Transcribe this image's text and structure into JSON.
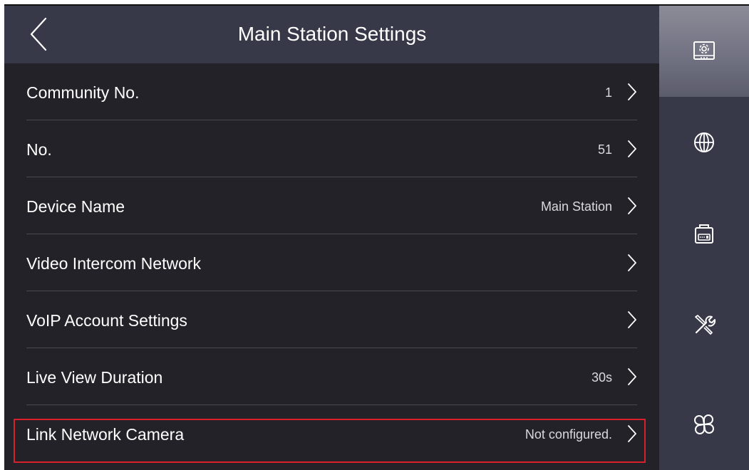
{
  "header": {
    "title": "Main Station Settings",
    "back_icon": "chevron-left-icon"
  },
  "settings": [
    {
      "label": "Community No.",
      "value": "1"
    },
    {
      "label": "No.",
      "value": "51"
    },
    {
      "label": "Device Name",
      "value": "Main Station"
    },
    {
      "label": "Video Intercom Network",
      "value": ""
    },
    {
      "label": "VoIP Account Settings",
      "value": ""
    },
    {
      "label": "Live View Duration",
      "value": "30s"
    },
    {
      "label": "Link Network Camera",
      "value": "Not configured.",
      "highlighted": true
    }
  ],
  "sidebar": {
    "items": [
      {
        "icon": "device-settings-icon",
        "active": true
      },
      {
        "icon": "globe-icon",
        "active": false
      },
      {
        "icon": "intercom-device-icon",
        "active": false
      },
      {
        "icon": "tools-icon",
        "active": false
      },
      {
        "icon": "apps-icon",
        "active": false
      }
    ]
  },
  "colors": {
    "background": "#232228",
    "header": "#383948",
    "sidebar": "#383948",
    "text": "#ffffff",
    "highlight_border": "#d9202a"
  }
}
